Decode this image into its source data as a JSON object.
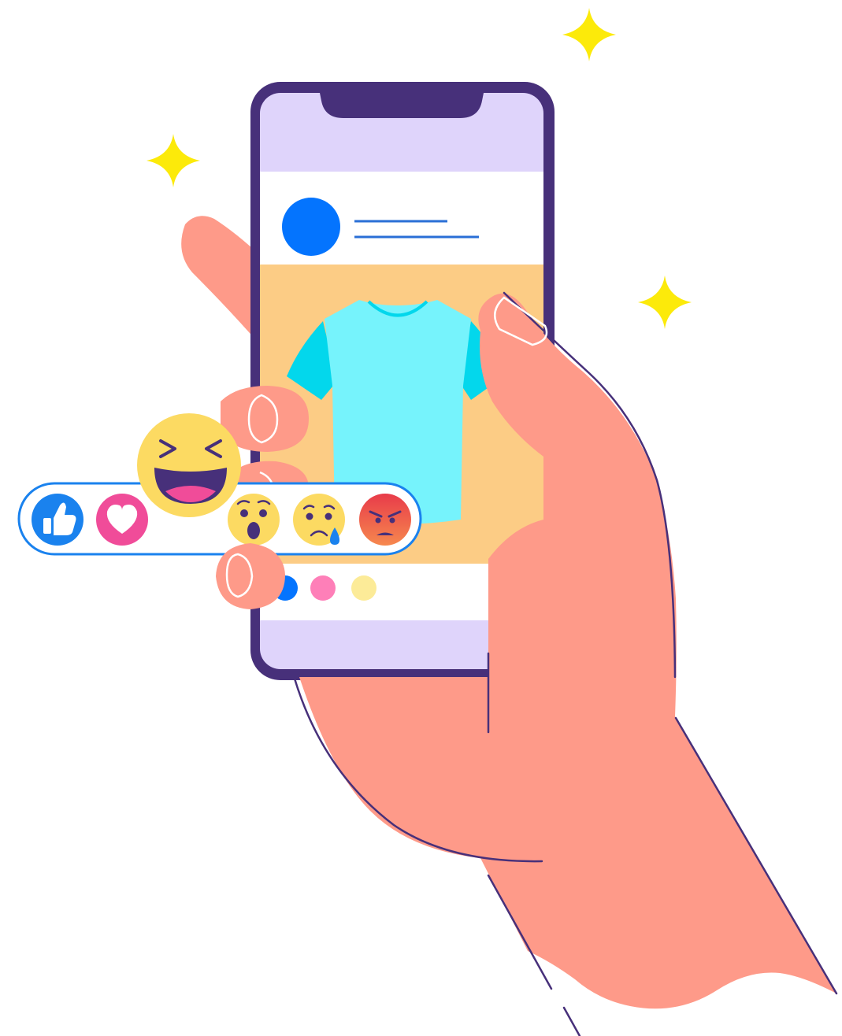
{
  "illustration": {
    "subject": "hand-holding-phone-with-social-post",
    "phone": {
      "screen_regions": [
        "status-area",
        "post-header",
        "post-image",
        "post-actions",
        "bottom-area"
      ],
      "post": {
        "avatar_icon": "avatar-circle-icon",
        "header_lines": 2,
        "image_icon": "t-shirt-icon",
        "indicator_dots": [
          "blue",
          "pink",
          "yellow"
        ]
      }
    },
    "reaction_bar": {
      "reactions": [
        {
          "name": "like",
          "icon": "thumbs-up-icon"
        },
        {
          "name": "love",
          "icon": "heart-icon"
        },
        {
          "name": "haha",
          "icon": "laughing-face-icon",
          "active": true
        },
        {
          "name": "wow",
          "icon": "surprised-face-icon"
        },
        {
          "name": "sad",
          "icon": "crying-face-icon"
        },
        {
          "name": "angry",
          "icon": "angry-face-icon"
        }
      ]
    },
    "sparkles": [
      "sparkle-top-right",
      "sparkle-left",
      "sparkle-right"
    ]
  },
  "colors": {
    "phone_frame": "#47307A",
    "screen_bg": "#DFD4FB",
    "post_bg": "#FFFFFF",
    "post_image_bg": "#FCCC85",
    "avatar": "#0474FE",
    "header_line": "#2A6FD6",
    "tshirt_body": "#76F3FC",
    "tshirt_sleeve": "#03D7EC",
    "skin": "#FE9A89",
    "outline": "#47307A",
    "sparkle": "#FCEA0A",
    "like_blue": "#1A82EE",
    "love_pink": "#F04C99",
    "emoji_yellow": "#FCDA62",
    "angry_top": "#E83B4A",
    "angry_bottom": "#F6884E",
    "dot_blue": "#0474FE",
    "dot_pink": "#FE7FB8",
    "dot_yellow": "#FCEB98"
  }
}
